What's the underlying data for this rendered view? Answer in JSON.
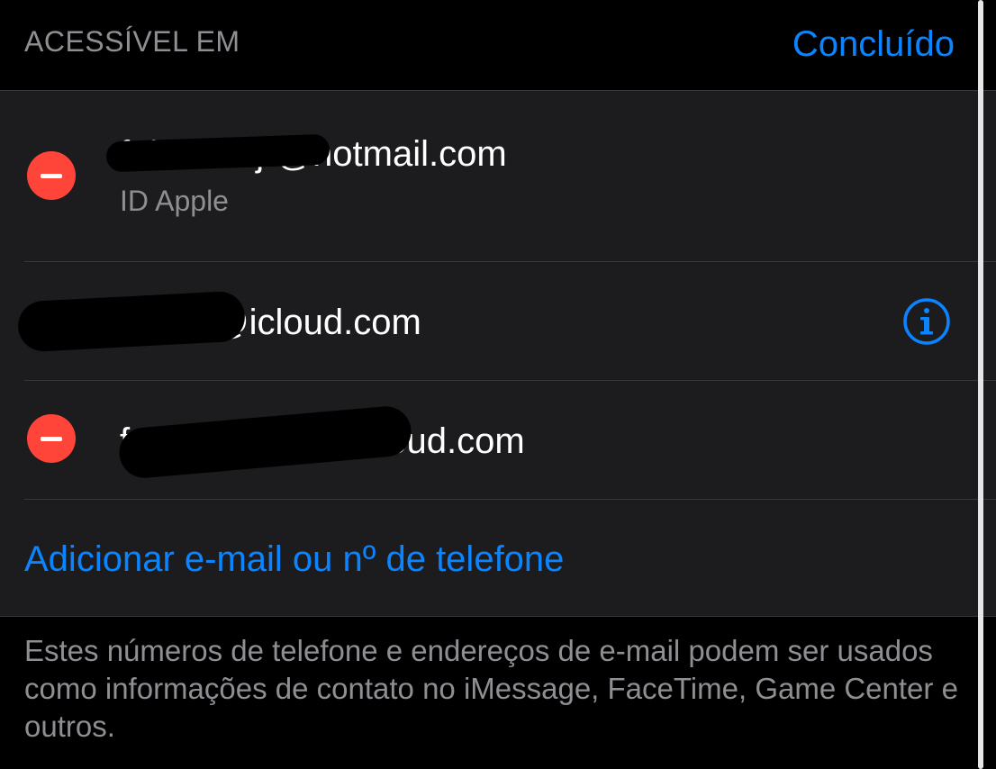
{
  "header": {
    "section_title": "ACESSÍVEL EM",
    "done_label": "Concluído"
  },
  "addresses": [
    {
      "email": "fabi         inhojr@hotmail.com",
      "subtitle": "ID Apple",
      "deletable": true
    },
    {
      "email": "fabio        nunior@icloud.com",
      "deletable": false,
      "has_info": true
    },
    {
      "email": "fabio        ojunior@icloud.com",
      "deletable": true
    }
  ],
  "add_link_label": "Adicionar e-mail ou nº de telefone",
  "footer_text": "Estes números de telefone e endereços de e-mail podem ser usados como informações de contato no iMessage, FaceTime, Game Center e outros.",
  "colors": {
    "accent": "#0a84ff",
    "delete": "#ff453a",
    "background": "#000000",
    "group_background": "#1c1c1e",
    "secondary_text": "#8e8e93"
  },
  "icons": {
    "delete": "minus-circle-icon",
    "info": "info-circle-icon"
  }
}
